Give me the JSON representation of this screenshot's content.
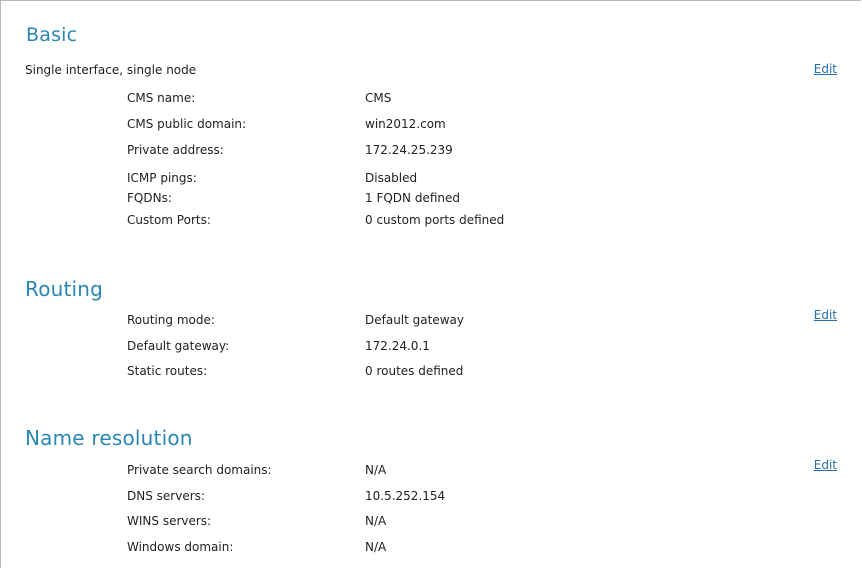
{
  "basic": {
    "title": "Basic",
    "subtitle": "Single interface, single node",
    "edit_label": "Edit",
    "rows": [
      {
        "label": "CMS name:",
        "value": "CMS"
      },
      {
        "label": "CMS public domain:",
        "value": "win2012.com"
      },
      {
        "label": "Private address:",
        "value": "172.24.25.239"
      },
      {
        "label": "ICMP pings:",
        "value": "Disabled"
      },
      {
        "label": "FQDNs:",
        "value": "1 FQDN defined"
      },
      {
        "label": "Custom Ports:",
        "value": "0 custom ports defined"
      }
    ]
  },
  "routing": {
    "title": "Routing",
    "edit_label": "Edit",
    "rows": [
      {
        "label": "Routing mode:",
        "value": "Default gateway"
      },
      {
        "label": "Default gateway:",
        "value": "172.24.0.1"
      },
      {
        "label": "Static routes:",
        "value": "0 routes defined"
      }
    ]
  },
  "name_resolution": {
    "title": "Name resolution",
    "edit_label": "Edit",
    "rows": [
      {
        "label": "Private search domains:",
        "value": "N/A"
      },
      {
        "label": "DNS servers:",
        "value": "10.5.252.154"
      },
      {
        "label": "WINS servers:",
        "value": "N/A"
      },
      {
        "label": "Windows domain:",
        "value": "N/A"
      }
    ]
  },
  "colors": {
    "heading": "#2a86b4",
    "link": "#2a6ea8",
    "text": "#222222",
    "border": "#b9b9b9"
  }
}
